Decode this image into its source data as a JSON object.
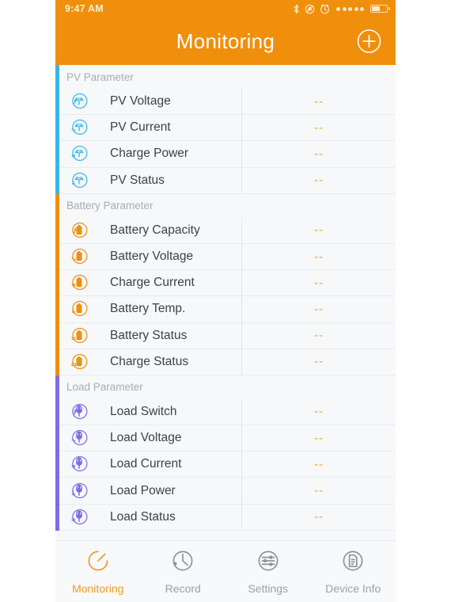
{
  "status_bar": {
    "time": "9:47 AM",
    "icons": [
      "bluetooth-icon",
      "silent-mode-icon",
      "alarm-icon",
      "signal-dots",
      "battery-icon"
    ],
    "signal_dots": 5,
    "battery_level_percent": 52
  },
  "header": {
    "title": "Monitoring",
    "add_button_label": "+",
    "background_color": "#ef8f0b"
  },
  "sections": [
    {
      "title": "PV Parameter",
      "accent_color": "#38b6ea",
      "icon_type": "solar-panel-icon",
      "rows": [
        {
          "label": "PV Voltage",
          "value": "--",
          "icon": "pv-voltage-icon"
        },
        {
          "label": "PV Current",
          "value": "--",
          "icon": "pv-current-icon"
        },
        {
          "label": "Charge Power",
          "value": "--",
          "icon": "charge-power-icon"
        },
        {
          "label": "PV Status",
          "value": "--",
          "icon": "pv-status-icon"
        }
      ]
    },
    {
      "title": "Battery Parameter",
      "accent_color": "#ef8f0b",
      "icon_type": "battery-icon",
      "rows": [
        {
          "label": "Battery Capacity",
          "value": "--",
          "icon": "battery-capacity-icon"
        },
        {
          "label": "Battery Voltage",
          "value": "--",
          "icon": "battery-voltage-icon"
        },
        {
          "label": "Charge Current",
          "value": "--",
          "icon": "charge-current-icon"
        },
        {
          "label": "Battery Temp.",
          "value": "--",
          "icon": "battery-temp-icon"
        },
        {
          "label": "Battery Status",
          "value": "--",
          "icon": "battery-status-icon"
        },
        {
          "label": "Charge Status",
          "value": "--",
          "icon": "charge-status-icon"
        }
      ]
    },
    {
      "title": "Load Parameter",
      "accent_color": "#7b6ce8",
      "icon_type": "plug-icon",
      "rows": [
        {
          "label": "Load Switch",
          "value": "--",
          "icon": "load-switch-icon"
        },
        {
          "label": "Load Voltage",
          "value": "--",
          "icon": "load-voltage-icon"
        },
        {
          "label": "Load Current",
          "value": "--",
          "icon": "load-current-icon"
        },
        {
          "label": "Load Power",
          "value": "--",
          "icon": "load-power-icon"
        },
        {
          "label": "Load Status",
          "value": "--",
          "icon": "load-status-icon"
        }
      ]
    }
  ],
  "tabbar": {
    "active_color": "#f09a23",
    "inactive_color": "#9ba0a8",
    "tabs": [
      {
        "label": "Monitoring",
        "icon": "gauge-icon",
        "active": true
      },
      {
        "label": "Record",
        "icon": "clock-icon",
        "active": false
      },
      {
        "label": "Settings",
        "icon": "sliders-icon",
        "active": false
      },
      {
        "label": "Device Info",
        "icon": "document-icon",
        "active": false
      }
    ]
  }
}
